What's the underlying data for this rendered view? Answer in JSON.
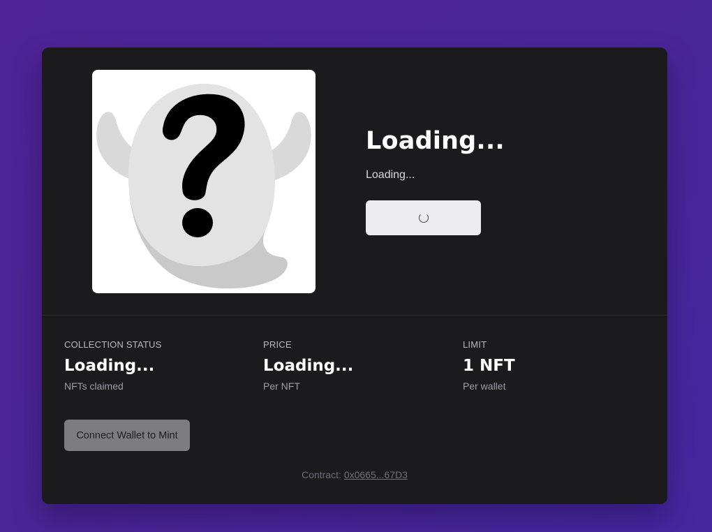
{
  "hero": {
    "title": "Loading...",
    "subtitle": "Loading..."
  },
  "stats": {
    "collection_status": {
      "label": "COLLECTION STATUS",
      "value": "Loading...",
      "sub": "NFTs claimed"
    },
    "price": {
      "label": "PRICE",
      "value": "Loading...",
      "sub": "Per NFT"
    },
    "limit": {
      "label": "LIMIT",
      "value": "1 NFT",
      "sub": "Per wallet"
    }
  },
  "actions": {
    "connect_label": "Connect Wallet to Mint"
  },
  "contract": {
    "prefix": "Contract: ",
    "address_short": "0x0665...67D3"
  },
  "colors": {
    "background_start": "#4f2394",
    "background_end": "#4428a0",
    "card": "#1b1b1d",
    "text_primary": "#ffffff",
    "text_muted": "#9d9da5",
    "button_light": "#ececef",
    "button_disabled": "#7d7d7f"
  }
}
